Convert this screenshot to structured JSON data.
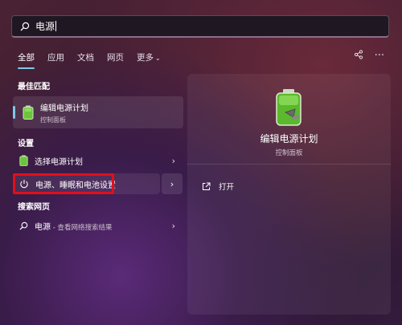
{
  "search": {
    "value": "电源"
  },
  "tabs": [
    {
      "label": "全部"
    },
    {
      "label": "应用"
    },
    {
      "label": "文档"
    },
    {
      "label": "网页"
    },
    {
      "label": "更多"
    }
  ],
  "sections": {
    "best_match": "最佳匹配",
    "settings": "设置",
    "web_search": "搜索网页"
  },
  "best_match": {
    "title": "编辑电源计划",
    "subtitle": "控制面板"
  },
  "settings_items": [
    {
      "label": "选择电源计划",
      "icon": "battery-icon"
    },
    {
      "label": "电源、睡眠和电池设置",
      "icon": "power-icon"
    }
  ],
  "web_item": {
    "label": "电源",
    "suffix": " - 查看网络搜索结果"
  },
  "preview": {
    "title": "编辑电源计划",
    "subtitle": "控制面板",
    "open_label": "打开"
  },
  "colors": {
    "accent": "#7ec8e8",
    "highlight": "#e0101a",
    "battery": "#7ed348"
  }
}
